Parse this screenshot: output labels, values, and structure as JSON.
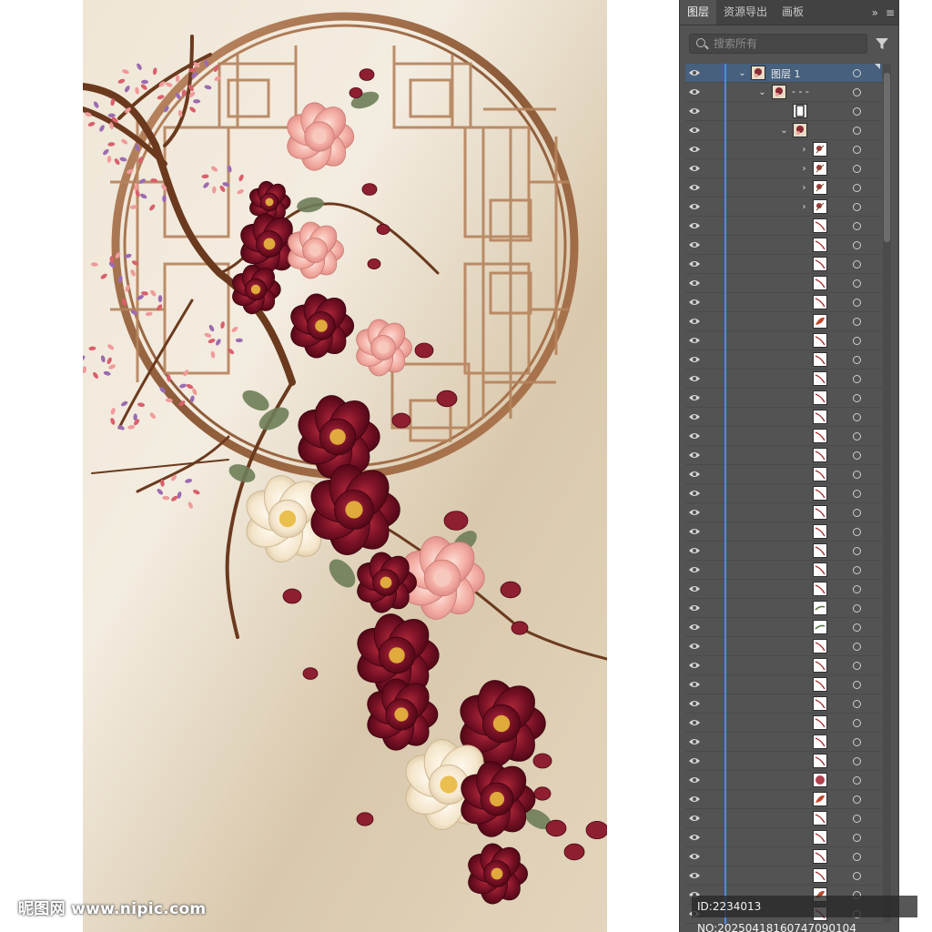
{
  "panel": {
    "tabs": [
      {
        "label": "图层",
        "active": true
      },
      {
        "label": "资源导出",
        "active": false
      },
      {
        "label": "画板",
        "active": false
      }
    ],
    "tab_tools": {
      "expand": "»",
      "menu": "≡"
    },
    "search": {
      "placeholder": "搜索所有"
    },
    "layers": [
      {
        "name": "图层 1",
        "level": 0,
        "expanded": true,
        "selected": true,
        "thumb": "art"
      },
      {
        "name": "- - -",
        "level": 1,
        "expanded": true,
        "thumb": "art"
      },
      {
        "name": "",
        "level": 2,
        "thumb": "frame"
      },
      {
        "name": "",
        "level": 2,
        "expanded": true,
        "thumb": "art"
      },
      {
        "name": "",
        "level": 3,
        "collapsed": true,
        "thumb": "flower"
      },
      {
        "name": "",
        "level": 3,
        "collapsed": true,
        "thumb": "flower"
      },
      {
        "name": "",
        "level": 3,
        "collapsed": true,
        "thumb": "flower"
      },
      {
        "name": "",
        "level": 3,
        "collapsed": true,
        "thumb": "flower"
      },
      {
        "name": "",
        "level": 4,
        "thumb": "stroke"
      },
      {
        "name": "",
        "level": 4,
        "thumb": "stroke"
      },
      {
        "name": "",
        "level": 4,
        "thumb": "stroke"
      },
      {
        "name": "",
        "level": 4,
        "thumb": "stroke"
      },
      {
        "name": "",
        "level": 4,
        "thumb": "stroke"
      },
      {
        "name": "",
        "level": 4,
        "thumb": "leaf"
      },
      {
        "name": "",
        "level": 4,
        "thumb": "stroke"
      },
      {
        "name": "",
        "level": 4,
        "thumb": "stroke"
      },
      {
        "name": "",
        "level": 4,
        "thumb": "stroke"
      },
      {
        "name": "",
        "level": 4,
        "thumb": "stroke"
      },
      {
        "name": "",
        "level": 4,
        "thumb": "stroke"
      },
      {
        "name": "",
        "level": 4,
        "thumb": "stroke"
      },
      {
        "name": "",
        "level": 4,
        "thumb": "stroke"
      },
      {
        "name": "",
        "level": 4,
        "thumb": "stroke"
      },
      {
        "name": "",
        "level": 4,
        "thumb": "stroke"
      },
      {
        "name": "",
        "level": 4,
        "thumb": "stroke"
      },
      {
        "name": "",
        "level": 4,
        "thumb": "stroke"
      },
      {
        "name": "",
        "level": 4,
        "thumb": "stroke"
      },
      {
        "name": "",
        "level": 4,
        "thumb": "stroke"
      },
      {
        "name": "",
        "level": 4,
        "thumb": "stroke"
      },
      {
        "name": "",
        "level": 4,
        "thumb": "green"
      },
      {
        "name": "",
        "level": 4,
        "thumb": "green"
      },
      {
        "name": "",
        "level": 4,
        "thumb": "stroke"
      },
      {
        "name": "",
        "level": 4,
        "thumb": "stroke"
      },
      {
        "name": "",
        "level": 4,
        "thumb": "stroke"
      },
      {
        "name": "",
        "level": 4,
        "thumb": "stroke"
      },
      {
        "name": "",
        "level": 4,
        "thumb": "stroke"
      },
      {
        "name": "",
        "level": 4,
        "thumb": "stroke"
      },
      {
        "name": "",
        "level": 4,
        "thumb": "stroke"
      },
      {
        "name": "",
        "level": 4,
        "thumb": "blob"
      },
      {
        "name": "",
        "level": 4,
        "thumb": "leaf"
      },
      {
        "name": "",
        "level": 4,
        "thumb": "stroke"
      },
      {
        "name": "",
        "level": 4,
        "thumb": "stroke"
      },
      {
        "name": "",
        "level": 4,
        "thumb": "stroke"
      },
      {
        "name": "",
        "level": 4,
        "thumb": "stroke"
      },
      {
        "name": "",
        "level": 4,
        "thumb": "leaf"
      },
      {
        "name": "",
        "level": 4,
        "thumb": "stroke"
      }
    ]
  },
  "watermark": {
    "left": "昵图网 www.nipic.com",
    "right": "ID:2234013 NO:20250418160747090104"
  },
  "colors": {
    "panel_bg": "#535353",
    "selection": "#46607e",
    "layer_color": "#4d88ff",
    "art_bg": "#ece3d3",
    "frame": "#a8734a",
    "burgundy": "#7c1326",
    "pink": "#f0a9a0",
    "cream": "#f6ead8"
  }
}
